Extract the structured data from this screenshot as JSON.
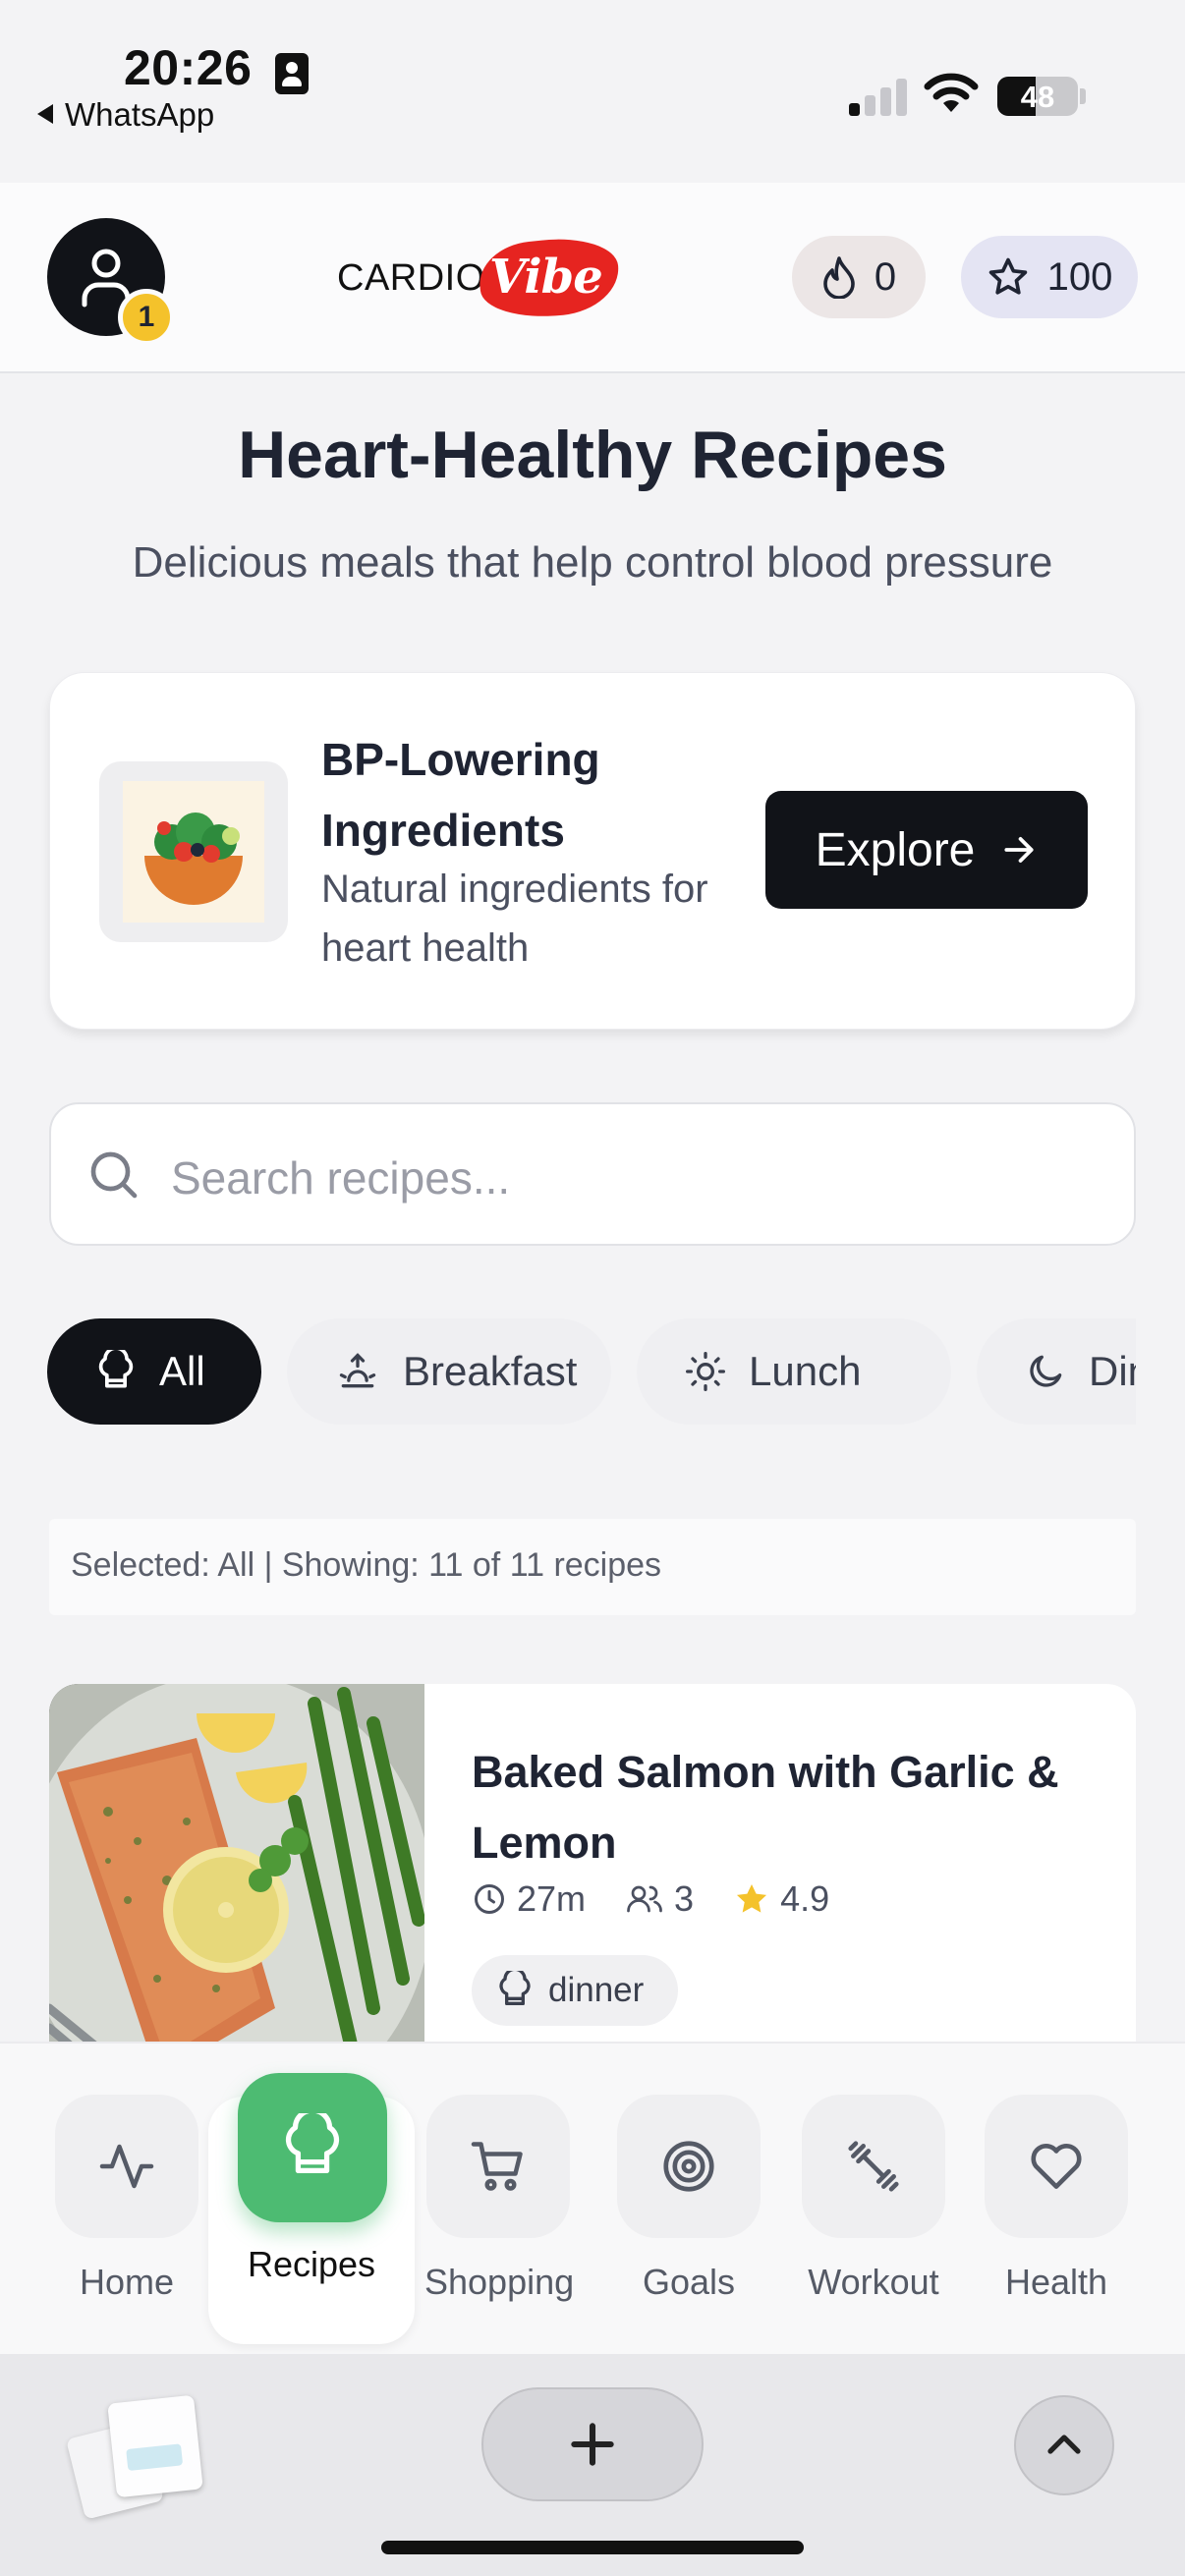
{
  "status_bar": {
    "time": "20:26",
    "back_app": "WhatsApp",
    "battery": "48"
  },
  "header": {
    "notification_count": "1",
    "logo_left": "CARDIO",
    "logo_right": "Vibe",
    "streak_count": "0",
    "stars_count": "100"
  },
  "page": {
    "title": "Heart-Healthy Recipes",
    "subtitle": "Delicious meals that help control blood pressure"
  },
  "promo": {
    "title": "BP-Lowering Ingredients",
    "description": "Natural ingredients for heart health",
    "button_label": "Explore"
  },
  "search": {
    "placeholder": "Search recipes..."
  },
  "filters": {
    "chips": [
      {
        "label": "All",
        "icon": "chef-hat-icon",
        "active": true
      },
      {
        "label": "Breakfast",
        "icon": "sunrise-icon",
        "active": false
      },
      {
        "label": "Lunch",
        "icon": "sun-icon",
        "active": false
      },
      {
        "label": "Dinner",
        "icon": "moon-icon",
        "active": false
      }
    ],
    "selected_summary": "Selected: All | Showing: 11 of 11 recipes"
  },
  "recipes": [
    {
      "title": "Baked Salmon with Garlic & Lemon",
      "time": "27m",
      "servings": "3",
      "rating": "4.9",
      "tag": "dinner"
    }
  ],
  "bottom_nav": {
    "items": [
      {
        "label": "Home",
        "icon": "activity-icon"
      },
      {
        "label": "Recipes",
        "icon": "chef-hat-icon",
        "active": true
      },
      {
        "label": "Shopping",
        "icon": "cart-icon"
      },
      {
        "label": "Goals",
        "icon": "target-icon"
      },
      {
        "label": "Workout",
        "icon": "dumbbell-icon"
      },
      {
        "label": "Health",
        "icon": "heart-icon"
      }
    ]
  },
  "colors": {
    "accent_green": "#4dbb72",
    "dark": "#111318",
    "star_yellow": "#f4c22b",
    "brand_red": "#e62420"
  }
}
